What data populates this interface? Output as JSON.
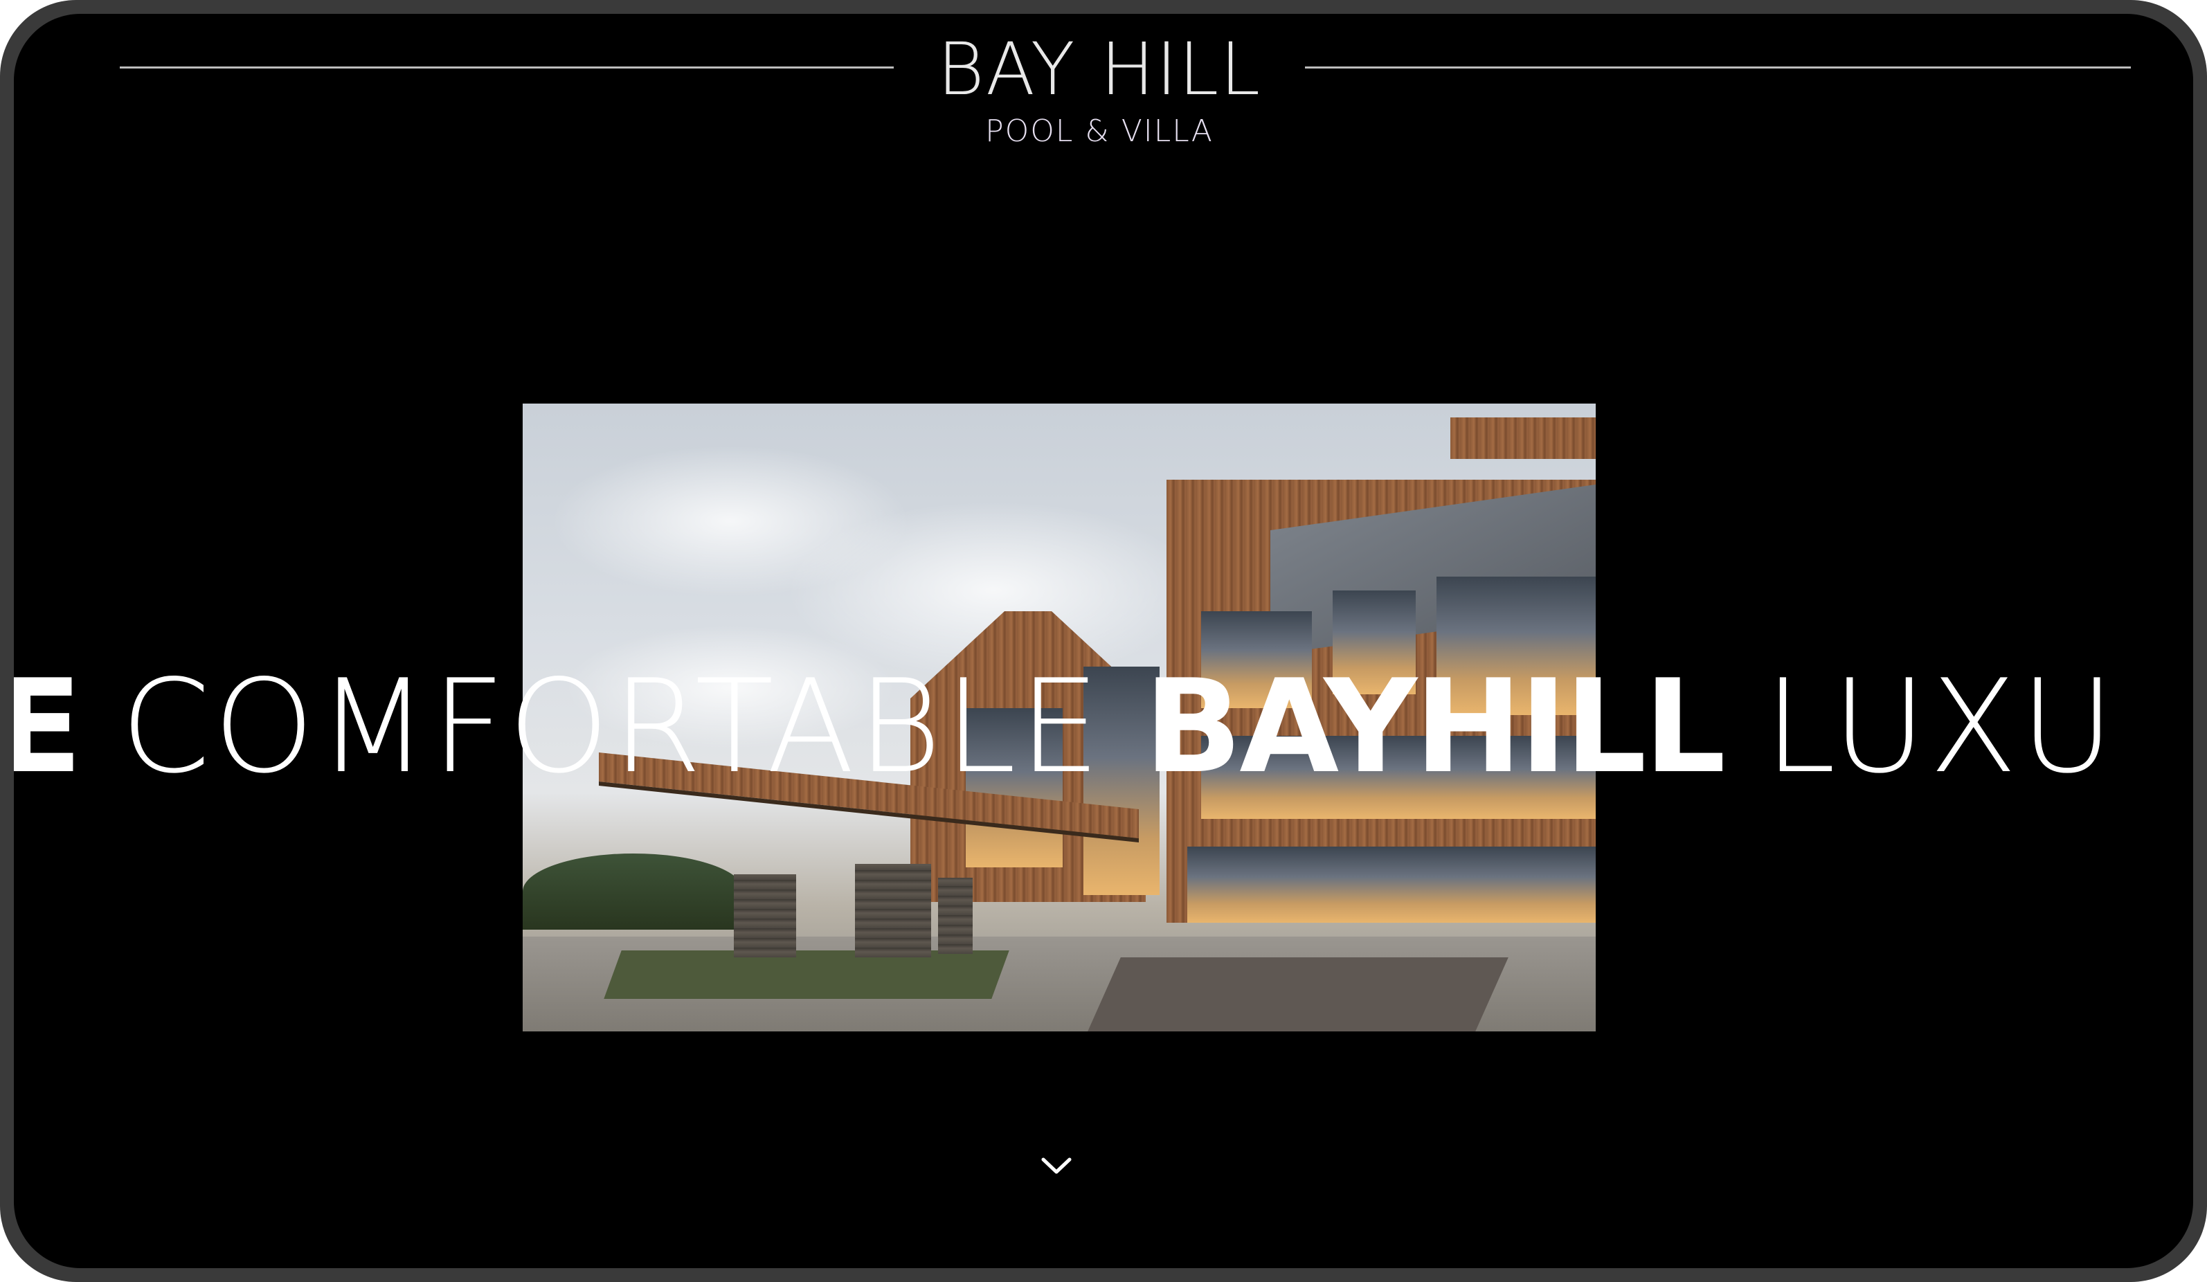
{
  "brand": {
    "title": "BAY HILL",
    "subtitle": "POOL & VILLA"
  },
  "hero": {
    "image_description_icon": "building-photo",
    "slogan": {
      "lead_fragment": "E",
      "part_light": "COMFORTABLE",
      "part_bold": "BAYHILL",
      "part_tail": "LUXU"
    }
  },
  "navigation": {
    "scroll_icon": "chevron-down-icon"
  },
  "colors": {
    "background": "#000000",
    "text": "#ffffff",
    "rule": "#bdbdbd",
    "frame": "#3a3a3a"
  }
}
